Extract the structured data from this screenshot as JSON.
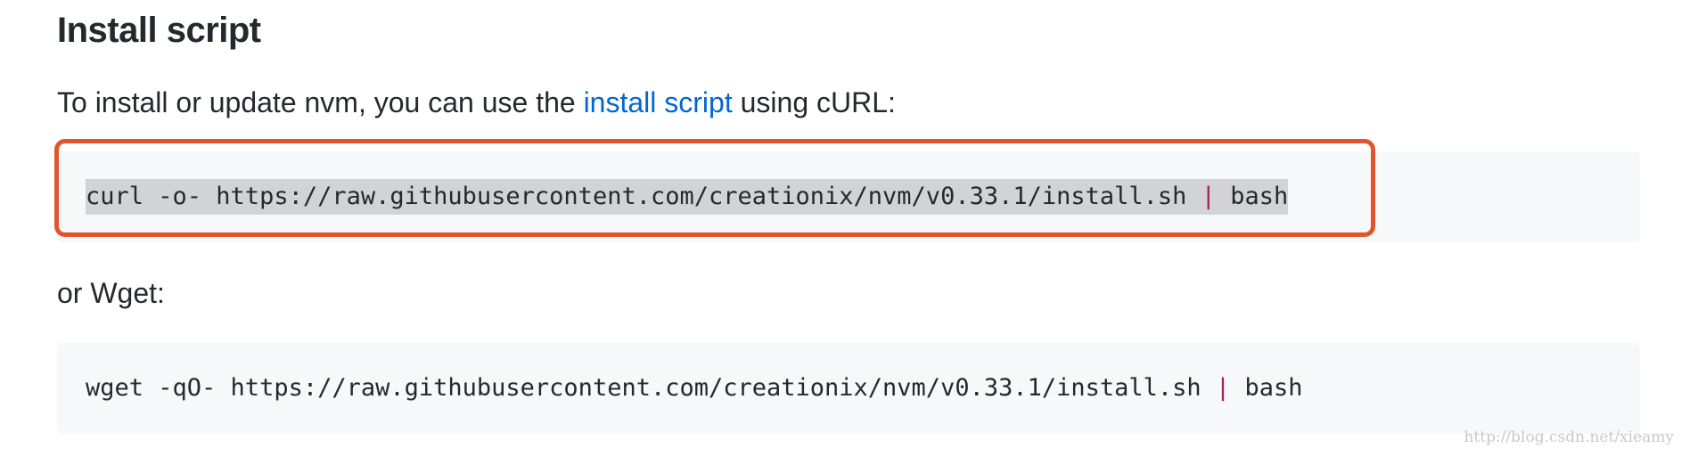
{
  "section": {
    "heading": "Install script",
    "curl_intro": {
      "before": "To install or update nvm, you can use the ",
      "link": "install script",
      "after": " using cURL:"
    },
    "curl_code": {
      "command": "curl -o- https://raw.githubusercontent.com/creationix/nvm/v0.33.1/install.sh ",
      "pipe": "|",
      "tail": " bash"
    },
    "wget_intro": "or Wget:",
    "wget_code": {
      "command": "wget -qO- https://raw.githubusercontent.com/creationix/nvm/v0.33.1/install.sh ",
      "pipe": "|",
      "tail": " bash"
    }
  },
  "watermark": "http://blog.csdn.net/xieamy",
  "colors": {
    "link": "#0366d6",
    "code_background": "#f6f8fa",
    "pipe": "#a71d5d",
    "highlight_box": "#e2542d",
    "selection": "#d2d3d5"
  }
}
